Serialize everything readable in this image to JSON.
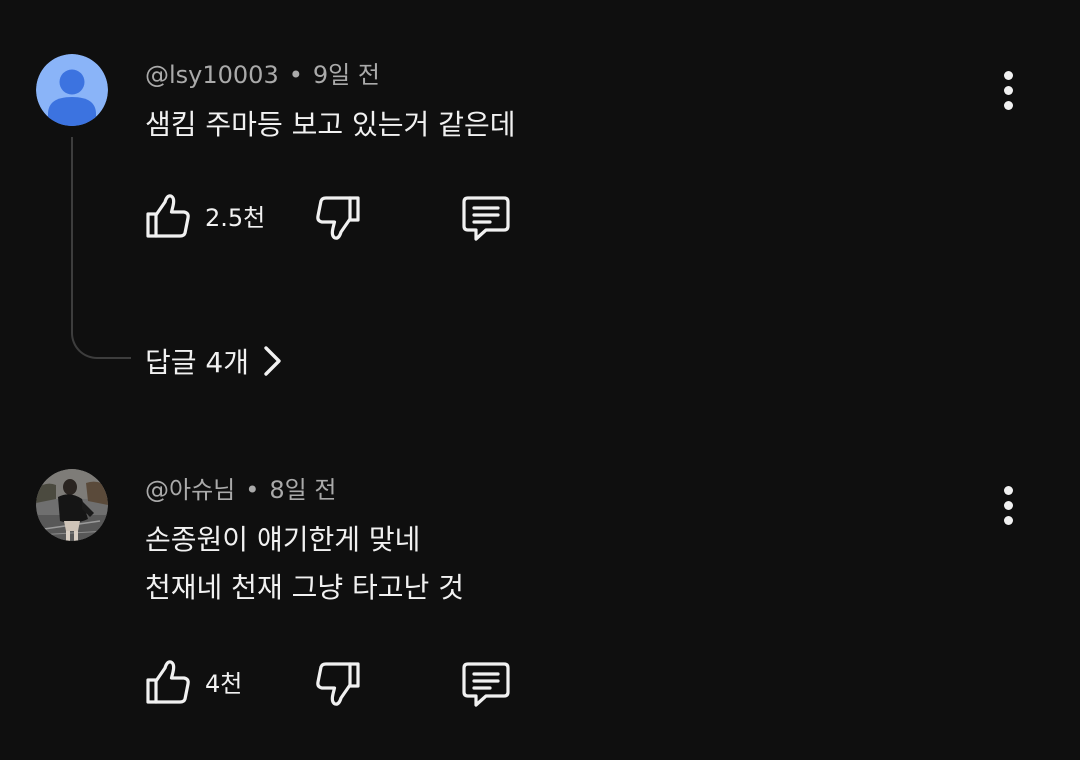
{
  "comments": [
    {
      "handle": "@lsy10003",
      "separator": "•",
      "time": "9일 전",
      "lines": [
        "샘킴 주마등 보고 있는거 같은데"
      ],
      "likes": "2.5천",
      "replies_label": "답글 4개",
      "avatar_icon": "default-person-avatar"
    },
    {
      "handle": "@아슈님",
      "separator": "•",
      "time": "8일 전",
      "lines": [
        "손종원이 얘기한게 맞네",
        "천재네 천재 그냥 타고난 것"
      ],
      "likes": "4천",
      "avatar_icon": "photo-avatar"
    }
  ],
  "icons": {
    "like": "thumbs-up-icon",
    "dislike": "thumbs-down-icon",
    "reply": "comment-reply-icon",
    "more": "more-vertical-icon",
    "chevron": "chevron-right-icon"
  },
  "colors": {
    "background": "#0f0f0f",
    "text": "#f1f1f1",
    "meta": "#aaaaaa",
    "avatar_bg": "#8ab4f8",
    "avatar_fg": "#3c73e0"
  }
}
